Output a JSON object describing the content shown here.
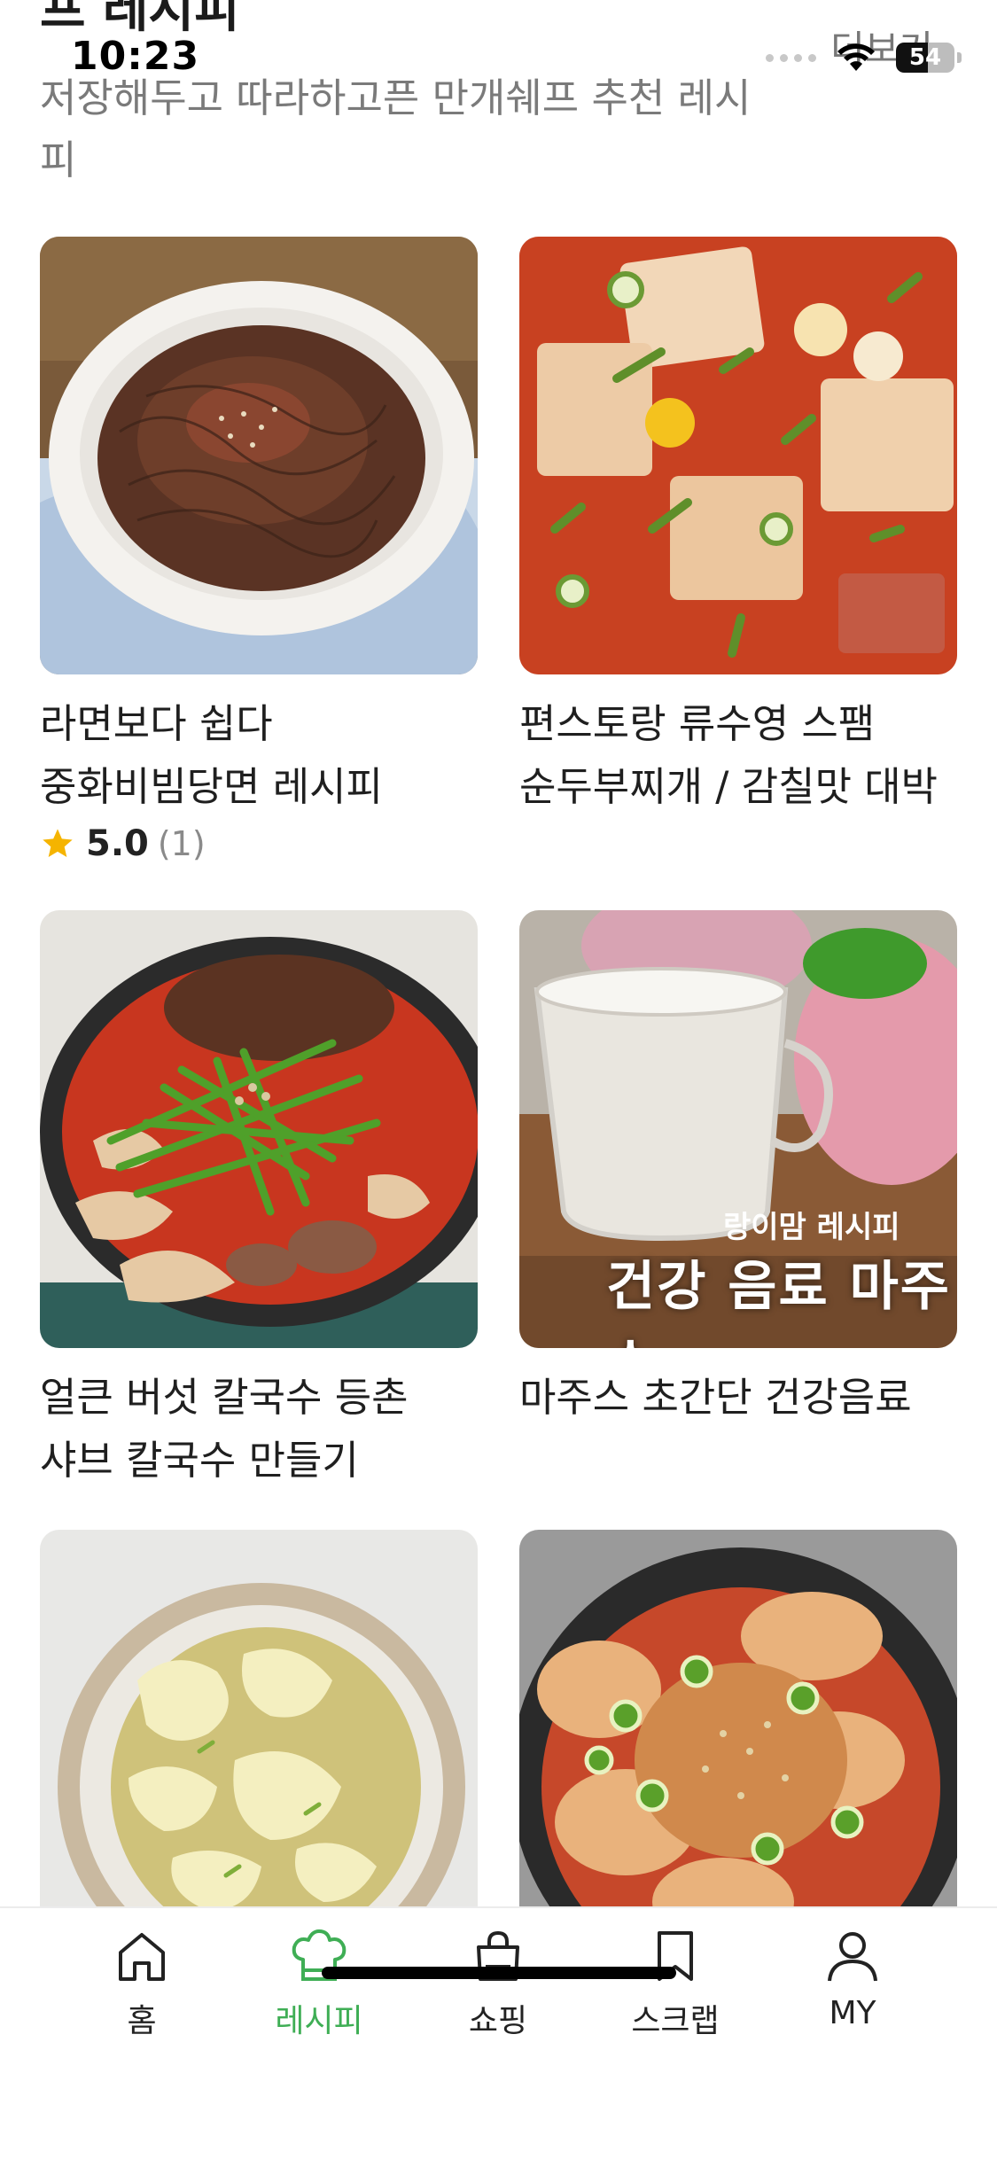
{
  "status_bar": {
    "time": "10:23",
    "battery_level": "54",
    "battery_fraction": 0.54
  },
  "section": {
    "title": "프 레시피",
    "more_label": "더보기",
    "subtitle": "저장해두고 따라하고픈 만개쉐프 추천 레시피"
  },
  "recipes": [
    {
      "title": "라면보다 쉽다 중화비빔당면 레시피",
      "rating": "5.0",
      "rating_count": "(1)",
      "image_icon": "glass-noodle-dish"
    },
    {
      "title": "편스토랑 류수영 스팸 순두부찌개 / 감칠맛 대박",
      "image_icon": "tofu-stew"
    },
    {
      "title": "얼큰 버섯 칼국수 등촌 샤브 칼국수 만들기",
      "image_icon": "mushroom-noodle-pot"
    },
    {
      "title": "마주스 초간단 건강음료",
      "image_icon": "yam-drink",
      "overlay_small": "랑이맘 레시피",
      "overlay_big": "건강 음료 마주스"
    },
    {
      "title": "",
      "image_icon": "egg-soup"
    },
    {
      "title": "",
      "image_icon": "spicy-braised-radish"
    }
  ],
  "tab_bar": {
    "tabs": [
      {
        "label": "홈",
        "icon": "home-icon",
        "active": false
      },
      {
        "label": "레시피",
        "icon": "chef-hat-icon",
        "active": true
      },
      {
        "label": "쇼핑",
        "icon": "shopping-bag-icon",
        "active": false
      },
      {
        "label": "스크랩",
        "icon": "bookmark-icon",
        "active": false
      },
      {
        "label": "MY",
        "icon": "person-icon",
        "active": false
      }
    ]
  },
  "colors": {
    "accent": "#3fae55",
    "star": "#f5b400",
    "muted_text": "#7a7a7a"
  }
}
